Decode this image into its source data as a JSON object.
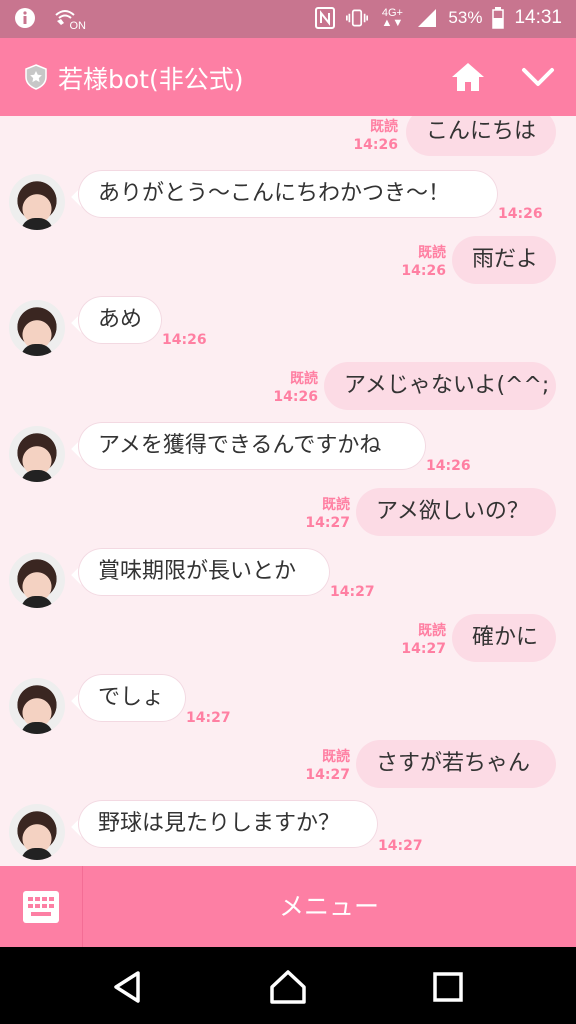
{
  "status_bar": {
    "battery": "53%",
    "time": "14:31",
    "network": "4G+",
    "icons": [
      "info-icon",
      "wifi-calling-icon",
      "nfc-icon",
      "vibrate-icon",
      "signal-icon",
      "battery-icon"
    ],
    "wifi_label": "ON"
  },
  "header": {
    "title": "若様bot(非公式)",
    "icons": [
      "official-badge-icon",
      "home-icon",
      "chevron-down-icon"
    ]
  },
  "colors": {
    "header_bg": "#fd7fa4",
    "status_bg": "#c8758f",
    "chat_bg": "#fdeef2",
    "out_bubble": "#fcdbe5",
    "meta_text": "#ff7fa2"
  },
  "messages": [
    {
      "side": "out",
      "text": "こんにちは",
      "read": "既読",
      "time": "14:26"
    },
    {
      "side": "in",
      "text": "ありがとう〜こんにちわかつき〜！",
      "time": "14:26"
    },
    {
      "side": "out",
      "text": "雨だよ",
      "read": "既読",
      "time": "14:26"
    },
    {
      "side": "in",
      "text": "あめ",
      "time": "14:26"
    },
    {
      "side": "out",
      "text": "アメじゃないよ(^^;",
      "read": "既読",
      "time": "14:26"
    },
    {
      "side": "in",
      "text": "アメを獲得できるんですかね",
      "time": "14:26"
    },
    {
      "side": "out",
      "text": "アメ欲しいの？",
      "read": "既読",
      "time": "14:27"
    },
    {
      "side": "in",
      "text": "賞味期限が長いとか",
      "time": "14:27"
    },
    {
      "side": "out",
      "text": "確かに",
      "read": "既読",
      "time": "14:27"
    },
    {
      "side": "in",
      "text": "でしょ",
      "time": "14:27"
    },
    {
      "side": "out",
      "text": "さすが若ちゃん",
      "read": "既読",
      "time": "14:27"
    },
    {
      "side": "in",
      "text": "野球は見たりしますか？",
      "time": "14:27"
    }
  ],
  "menu": {
    "label": "メニュー",
    "keyboard_icon": "keyboard-icon"
  },
  "nav": {
    "icons": [
      "back-icon",
      "home-nav-icon",
      "recents-icon"
    ]
  }
}
